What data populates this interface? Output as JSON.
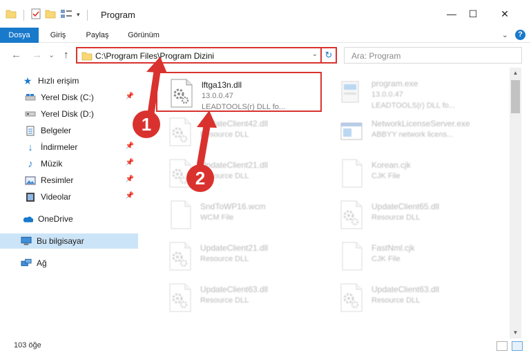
{
  "window": {
    "title": "Program",
    "minimize": "—",
    "maximize": "☐",
    "close": "✕"
  },
  "ribbon": {
    "tabs": [
      "Dosya",
      "Giriş",
      "Paylaş",
      "Görünüm"
    ],
    "help": "?"
  },
  "nav": {
    "back": "←",
    "forward": "→",
    "recent": "⌄",
    "up": "↑",
    "address": "C:\\Program Files\\Program Dizini",
    "refresh": "↻",
    "search_placeholder": "Ara: Program"
  },
  "sidebar": {
    "items": [
      {
        "label": "Hızlı erişim",
        "icon": "star-icon"
      },
      {
        "label": "Yerel Disk (C:)",
        "icon": "drive-c-icon"
      },
      {
        "label": "Yerel Disk (D:)",
        "icon": "drive-d-icon"
      },
      {
        "label": "Belgeler",
        "icon": "documents-icon"
      },
      {
        "label": "İndirmeler",
        "icon": "downloads-icon"
      },
      {
        "label": "Müzik",
        "icon": "music-icon"
      },
      {
        "label": "Resimler",
        "icon": "pictures-icon"
      },
      {
        "label": "Videolar",
        "icon": "videos-icon"
      },
      {
        "label": "OneDrive",
        "icon": "onedrive-icon"
      },
      {
        "label": "Bu bilgisayar",
        "icon": "this-pc-icon"
      },
      {
        "label": "Ağ",
        "icon": "network-icon"
      }
    ]
  },
  "files": [
    {
      "name": "lftga13n.dll",
      "line1": "13.0.0.47",
      "line2": "LEADTOOLS(r) DLL fo...",
      "icon": "dll-gear-icon"
    },
    {
      "name": "program.exe",
      "line1": "13.0.0.47",
      "line2": "LEADTOOLS(r) DLL fo...",
      "icon": "exe-icon"
    },
    {
      "name": "UpdateClient42.dll",
      "line1": "Resource DLL",
      "line2": "",
      "icon": "dll-gear-icon"
    },
    {
      "name": "NetworkLicenseServer.exe",
      "line1": "ABBYY network licens...",
      "line2": "",
      "icon": "exe-window-icon"
    },
    {
      "name": "UpdateClient21.dll",
      "line1": "Resource DLL",
      "line2": "",
      "icon": "dll-gear-icon"
    },
    {
      "name": "Korean.cjk",
      "line1": "CJK File",
      "line2": "",
      "icon": "blank-file-icon"
    },
    {
      "name": "SndToWP16.wcm",
      "line1": "WCM File",
      "line2": "",
      "icon": "blank-file-icon"
    },
    {
      "name": "UpdateClient65.dll",
      "line1": "Resource DLL",
      "line2": "",
      "icon": "dll-gear-icon"
    },
    {
      "name": "UpdateClient21.dll",
      "line1": "Resource DLL",
      "line2": "",
      "icon": "dll-gear-icon"
    },
    {
      "name": "FastNml.cjk",
      "line1": "CJK File",
      "line2": "",
      "icon": "blank-file-icon"
    },
    {
      "name": "UpdateClient63.dll",
      "line1": "Resource DLL",
      "line2": "",
      "icon": "dll-gear-icon"
    },
    {
      "name": "UpdateClient63.dll",
      "line1": "Resource DLL",
      "line2": "",
      "icon": "dll-gear-icon"
    }
  ],
  "status": {
    "count": "103 öğe"
  },
  "annotations": {
    "badge1": "1",
    "badge2": "2",
    "color": "#d9322e"
  },
  "colors": {
    "accent": "#1979ca",
    "selected": "#cce4f7",
    "highlight": "#d9322e"
  }
}
